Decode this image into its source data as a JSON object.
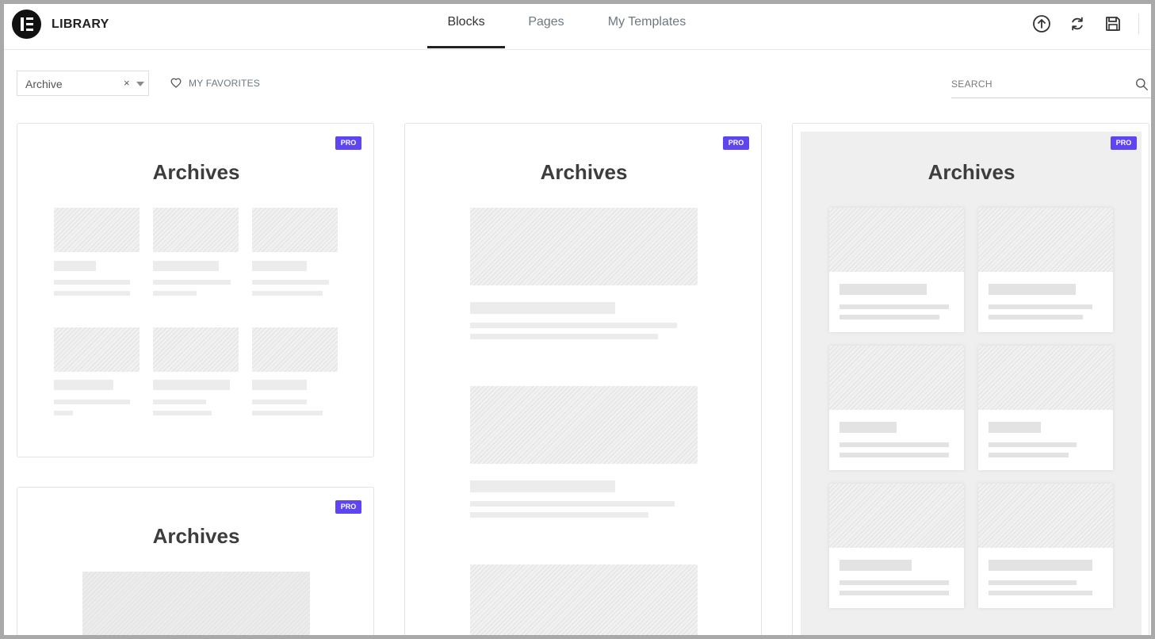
{
  "header": {
    "title": "LIBRARY",
    "tabs": [
      {
        "label": "Blocks",
        "active": true
      },
      {
        "label": "Pages",
        "active": false
      },
      {
        "label": "My Templates",
        "active": false
      }
    ],
    "icons": [
      "upload-icon",
      "sync-icon",
      "save-icon"
    ]
  },
  "toolbar": {
    "filter_value": "Archive",
    "filter_clear": "×",
    "favorites_label": "MY FAVORITES",
    "search_placeholder": "SEARCH"
  },
  "colors": {
    "pro_badge": "#5d46f2",
    "active_tab_underline": "#222222",
    "card_border": "#e1e3e5"
  },
  "templates": [
    {
      "badge": "PRO",
      "title": "Archives",
      "layout": "three-column-grid"
    },
    {
      "badge": "PRO",
      "title": "Archives",
      "layout": "single-column-list"
    },
    {
      "badge": "PRO",
      "title": "Archives",
      "layout": "two-column-cards"
    },
    {
      "badge": "PRO",
      "title": "Archives",
      "layout": "single-column-list"
    }
  ]
}
